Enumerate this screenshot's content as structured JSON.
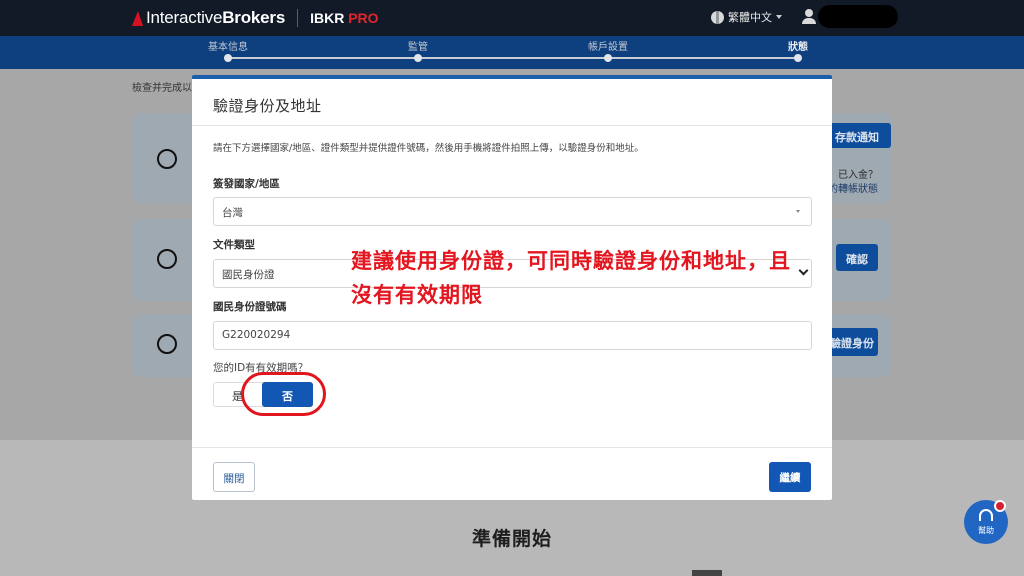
{
  "topbar": {
    "brand_regular": "Interactive",
    "brand_bold": "Brokers",
    "product": "IBKR",
    "product_accent": "PRO",
    "language": "繁體中文"
  },
  "progress": {
    "steps": [
      {
        "label": "基本信息",
        "active": false
      },
      {
        "label": "監管",
        "active": false
      },
      {
        "label": "帳戶設置",
        "active": false
      },
      {
        "label": "狀態",
        "active": true
      }
    ]
  },
  "background": {
    "note": "檢查并完成以",
    "card1_button": "存款通知",
    "card1_side_text": "已入金？",
    "card1_side_link": "的轉帳狀態",
    "card2_button": "確認",
    "card3_button": "驗證身份",
    "heading": "準備開始"
  },
  "modal": {
    "title": "驗證身份及地址",
    "intro": "請在下方選擇國家/地區、證件類型并提供證件號碼，然後用手機將證件拍照上傳，以驗證身份和地址。",
    "country_label": "簽發國家/地區",
    "country_value": "台灣",
    "doctype_label": "文件類型",
    "doctype_value": "國民身份證",
    "idnumber_label": "國民身份證號碼",
    "idnumber_value": "G220020294",
    "expiry_question": "您的ID有有效期嗎？",
    "yes_label": "是",
    "no_label": "否",
    "close_label": "關閉",
    "continue_label": "繼續"
  },
  "annotation": {
    "text": "建議使用身份證，可同時驗證身份和地址，且沒有有效期限"
  },
  "help": {
    "label": "幫助"
  },
  "colors": {
    "topbar": "#121a27",
    "progress_bar": "#0e407f",
    "primary_button": "#1257b4",
    "annotation_red": "#e3161f"
  }
}
